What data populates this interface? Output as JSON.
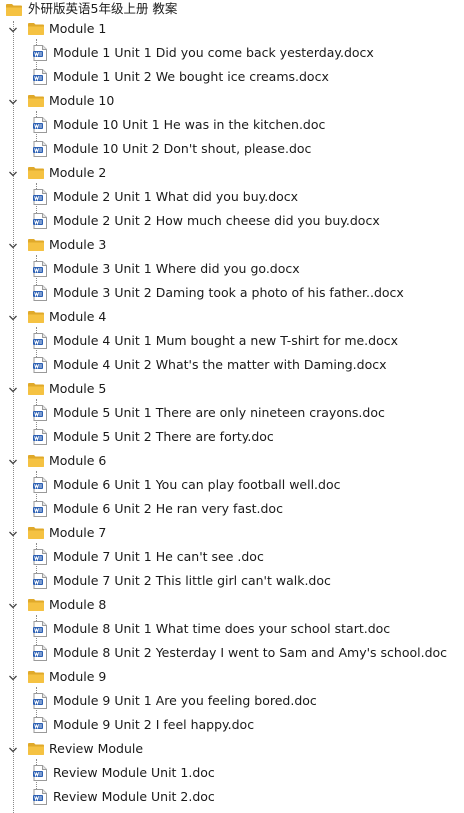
{
  "root": {
    "label": "外研版英语5年级上册 教案",
    "icon": "folder-icon",
    "folder_color": "#f5c242"
  },
  "modules": [
    {
      "label": "Module 1",
      "files": [
        "Module 1 Unit 1 Did you come back yesterday.docx",
        "Module 1 Unit 2 We bought ice creams.docx"
      ]
    },
    {
      "label": "Module 10",
      "files": [
        "Module 10 Unit 1 He was in the kitchen.doc",
        "Module 10 Unit 2 Don't shout, please.doc"
      ]
    },
    {
      "label": "Module 2",
      "files": [
        "Module 2 Unit 1 What did you buy.docx",
        "Module 2 Unit 2 How much cheese did you buy.docx"
      ]
    },
    {
      "label": "Module 3",
      "files": [
        "Module 3 Unit 1 Where did you go.docx",
        "Module 3 Unit 2 Daming took a photo of his father..docx"
      ]
    },
    {
      "label": "Module 4",
      "files": [
        "Module 4 Unit 1 Mum bought a new T-shirt for me.docx",
        "Module 4 Unit 2 What's the matter with Daming.docx"
      ]
    },
    {
      "label": "Module 5",
      "files": [
        "Module 5 Unit 1 There are only nineteen crayons.doc",
        "Module 5 Unit 2 There are forty.doc"
      ]
    },
    {
      "label": "Module 6",
      "files": [
        "Module 6 Unit 1 You can play football well.doc",
        "Module 6 Unit 2 He ran very fast.doc"
      ]
    },
    {
      "label": "Module 7",
      "files": [
        "Module 7 Unit 1 He can't see .doc",
        "Module 7 Unit 2 This little girl can't walk.doc"
      ]
    },
    {
      "label": "Module 8",
      "files": [
        "Module 8 Unit 1 What time does your school start.doc",
        "Module 8 Unit 2 Yesterday I went to Sam and Amy's school.doc"
      ]
    },
    {
      "label": "Module 9",
      "files": [
        "Module 9 Unit 1 Are you feeling bored.doc",
        "Module 9 Unit 2 I feel happy.doc"
      ]
    },
    {
      "label": "Review Module",
      "files": [
        "Review Module Unit 1.doc",
        "Review Module Unit 2.doc"
      ]
    }
  ],
  "icons": {
    "folder": "folder-icon",
    "document": "word-document-icon",
    "expander": "chevron-down-icon"
  },
  "colors": {
    "folder": "#f5c242",
    "folder_dark": "#e0a92a",
    "doc_badge": "#2b5fb3",
    "tree_lines": "#8a8a8a"
  }
}
